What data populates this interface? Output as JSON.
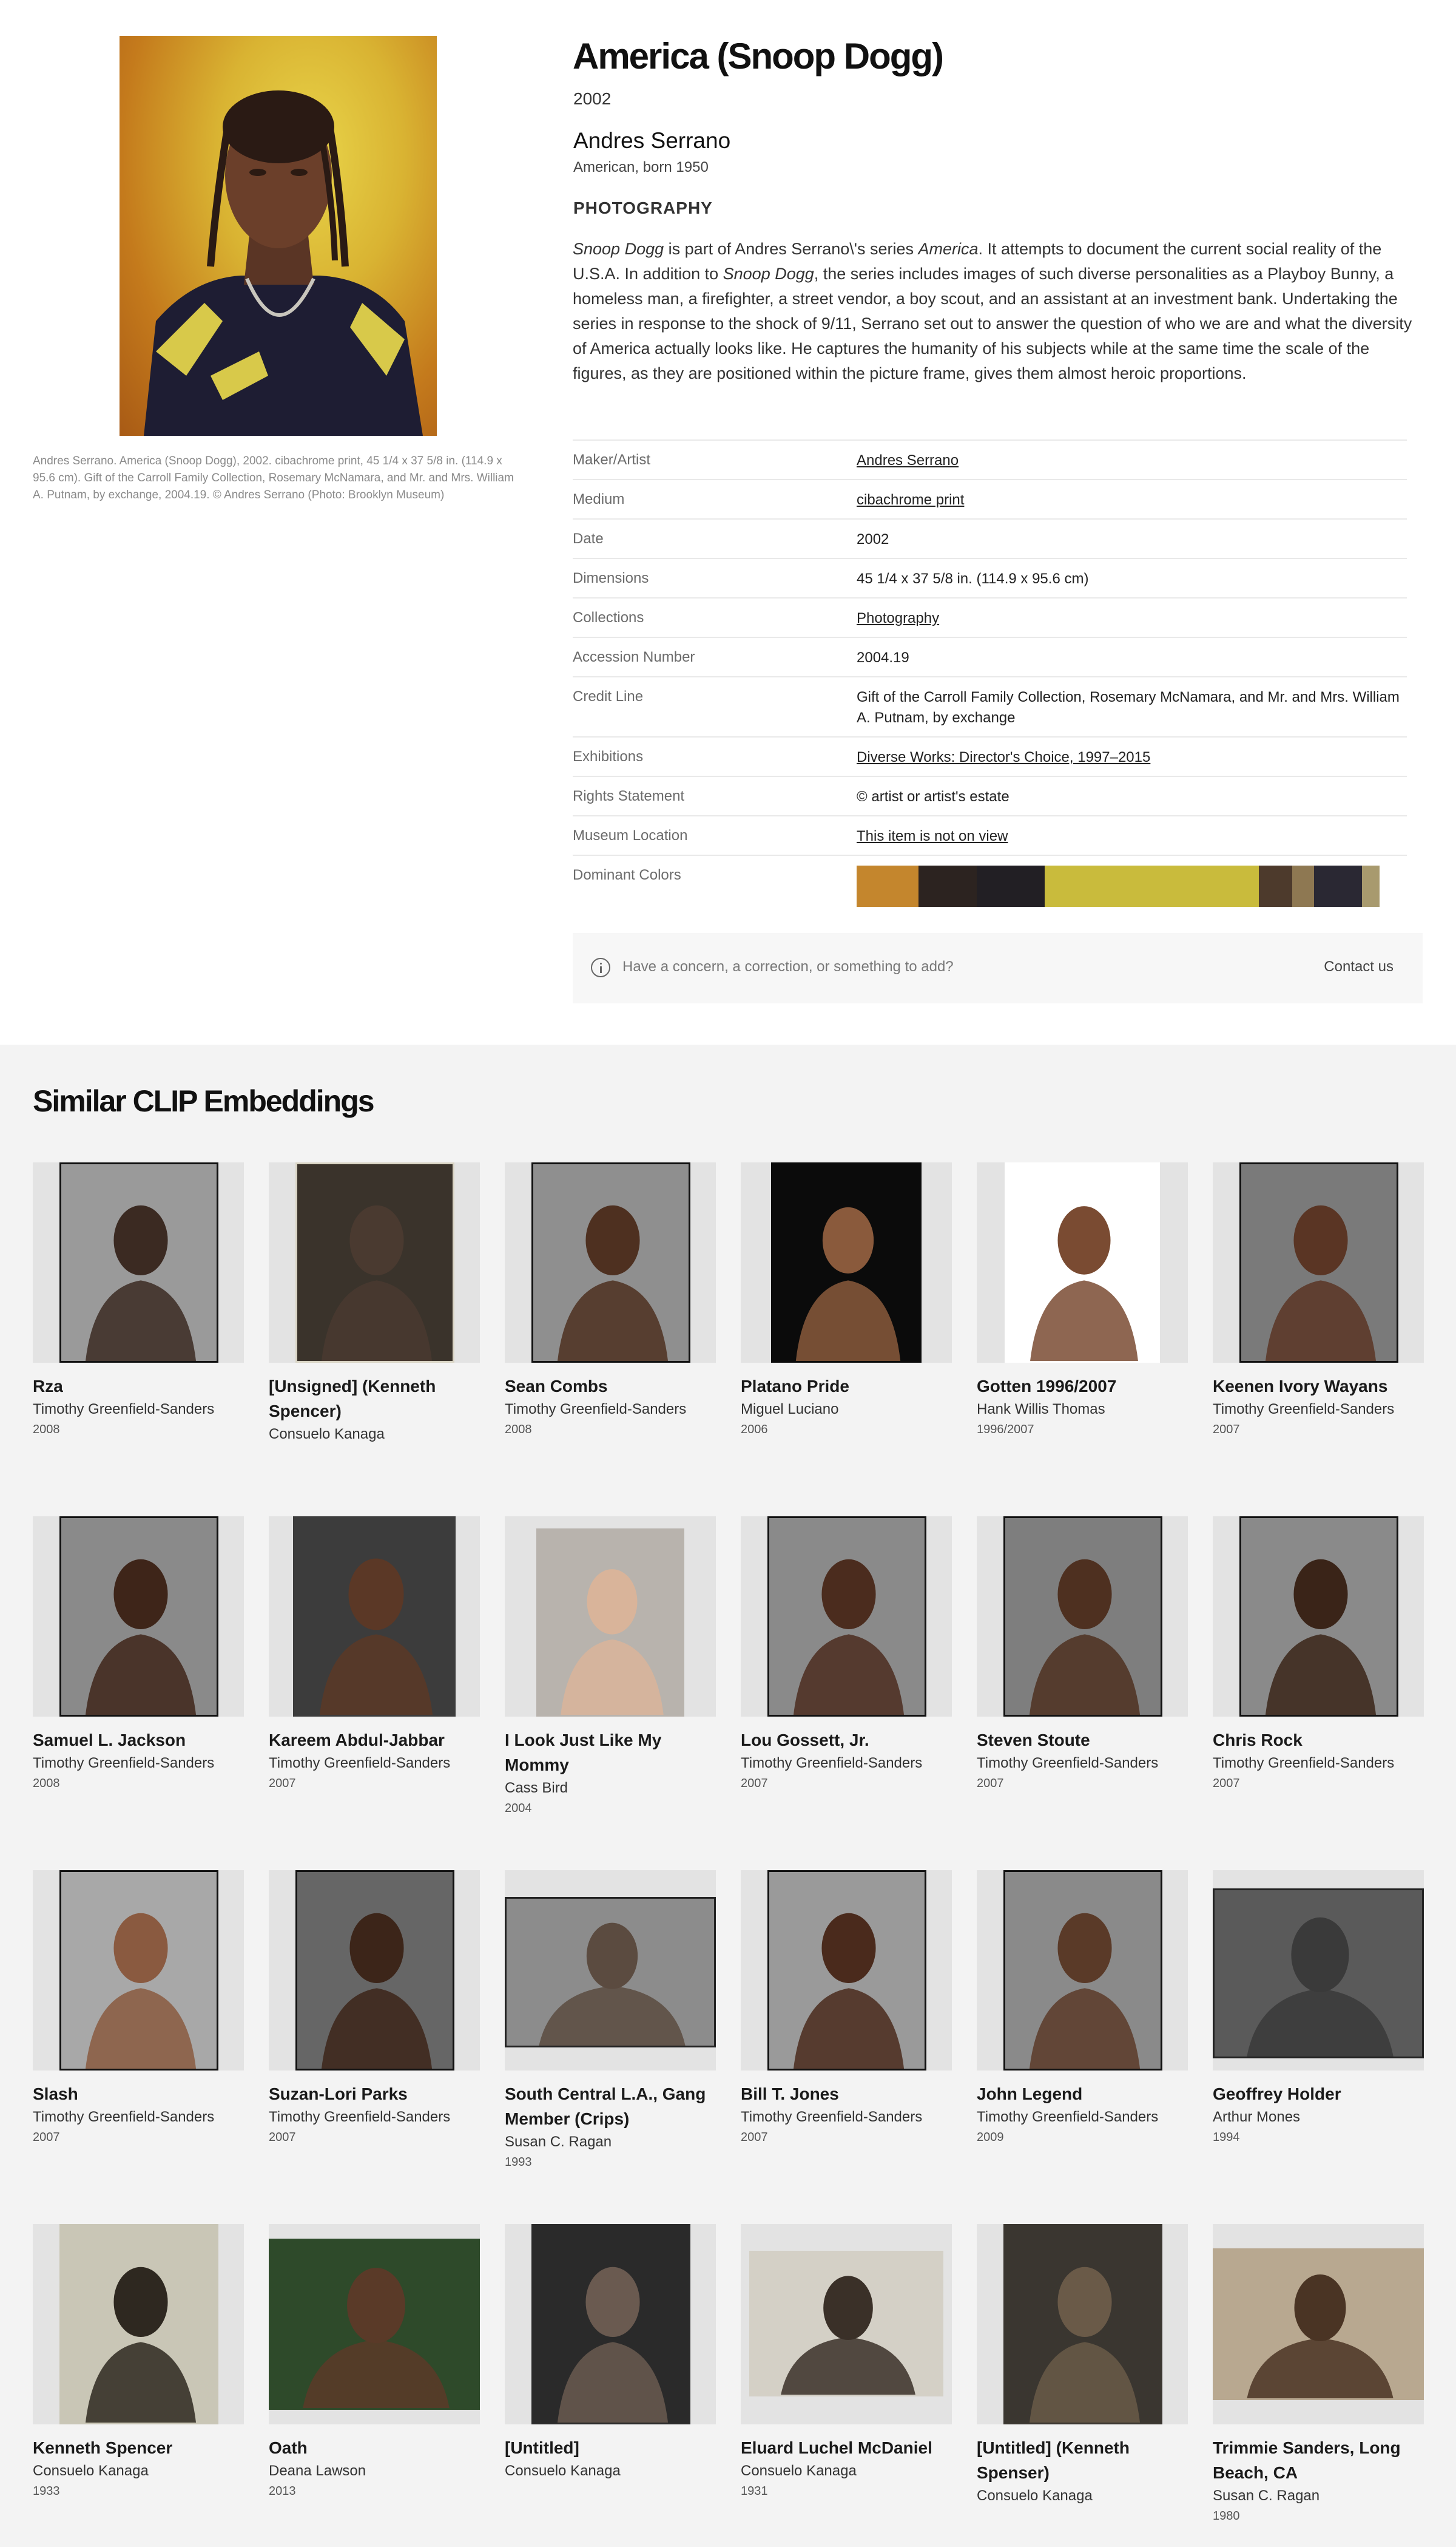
{
  "artwork": {
    "title": "America (Snoop Dogg)",
    "year": "2002",
    "artist": "Andres Serrano",
    "nationality": "American, born 1950",
    "classification": "PHOTOGRAPHY",
    "image_caption": "Andres Serrano. America (Snoop Dogg), 2002. cibachrome print, 45 1/4 x 37 5/8 in. (114.9 x 95.6 cm). Gift of the Carroll Family Collection, Rosemary McNamara, and Mr. and Mrs. William A. Putnam, by exchange, 2004.19. © Andres Serrano (Photo: Brooklyn Museum)",
    "description": {
      "p1_italic": "Snoop Dogg",
      "p2": " is part of Andres Serrano\\'s series ",
      "p3_italic": "America",
      "p4": ". It attempts to document the current social reality of the U.S.A. In addition to ",
      "p5_italic": "Snoop Dogg",
      "p6": ", the series includes images of such diverse personalities as a Playboy Bunny, a homeless man, a firefighter, a street vendor, a boy scout, and an assistant at an investment bank. Undertaking the series in response to the shock of 9/11, Serrano set out to answer the question of who we are and what the diversity of America actually looks like. He captures the humanity of his subjects while at the same time the scale of the figures, as they are positioned within the picture frame, gives them almost heroic proportions."
    }
  },
  "metadata": [
    {
      "label": "Maker/Artist",
      "value": "Andres Serrano",
      "link": true
    },
    {
      "label": "Medium",
      "value": "cibachrome print",
      "link": true
    },
    {
      "label": "Date",
      "value": "2002",
      "link": false
    },
    {
      "label": "Dimensions",
      "value": "45 1/4 x 37 5/8 in. (114.9 x 95.6 cm)",
      "link": false
    },
    {
      "label": "Collections",
      "value": "Photography",
      "link": true
    },
    {
      "label": "Accession Number",
      "value": "2004.19",
      "link": false
    },
    {
      "label": "Credit Line",
      "value": "Gift of the Carroll Family Collection, Rosemary McNamara, and Mr. and Mrs. William A. Putnam, by exchange",
      "link": false
    },
    {
      "label": "Exhibitions",
      "value": "Diverse Works: Director's Choice, 1997–2015",
      "link": true
    },
    {
      "label": "Rights Statement",
      "value": "© artist or artist's estate",
      "link": false
    },
    {
      "label": "Museum Location",
      "value": "This item is not on view",
      "link": true
    },
    {
      "label": "Dominant Colors",
      "value": null,
      "link": false
    }
  ],
  "dominant_colors": [
    {
      "color": "#c4862d",
      "share": 0.112
    },
    {
      "color": "#2c2320",
      "share": 0.106
    },
    {
      "color": "#221f24",
      "share": 0.124
    },
    {
      "color": "#c9bb3c",
      "share": 0.389
    },
    {
      "color": "#4d3a2c",
      "share": 0.061
    },
    {
      "color": "#8e7852",
      "share": 0.039
    },
    {
      "color": "#2a2833",
      "share": 0.088
    },
    {
      "color": "#a89a6e",
      "share": 0.032
    }
  ],
  "concern": {
    "text": "Have a concern, a correction, or something to add?",
    "contact": "Contact us"
  },
  "similar": {
    "heading": "Similar CLIP Embeddings",
    "items": [
      {
        "title": "Rza",
        "artist": "Timothy Greenfield-Sanders",
        "date": "2008"
      },
      {
        "title": "[Unsigned] (Kenneth Spencer)",
        "artist": "Consuelo Kanaga",
        "date": ""
      },
      {
        "title": "Sean Combs",
        "artist": "Timothy Greenfield-Sanders",
        "date": "2008"
      },
      {
        "title": "Platano Pride",
        "artist": "Miguel Luciano",
        "date": "2006"
      },
      {
        "title": "Gotten 1996/2007",
        "artist": "Hank Willis Thomas",
        "date": "1996/2007"
      },
      {
        "title": "Keenen Ivory Wayans",
        "artist": "Timothy Greenfield-Sanders",
        "date": "2007"
      },
      {
        "title": "Samuel L. Jackson",
        "artist": "Timothy Greenfield-Sanders",
        "date": "2008"
      },
      {
        "title": "Kareem Abdul-Jabbar",
        "artist": "Timothy Greenfield-Sanders",
        "date": "2007"
      },
      {
        "title": "I Look Just Like My Mommy",
        "artist": "Cass Bird",
        "date": "2004"
      },
      {
        "title": "Lou Gossett, Jr.",
        "artist": "Timothy Greenfield-Sanders",
        "date": "2007"
      },
      {
        "title": "Steven Stoute",
        "artist": "Timothy Greenfield-Sanders",
        "date": "2007"
      },
      {
        "title": "Chris Rock",
        "artist": "Timothy Greenfield-Sanders",
        "date": "2007"
      },
      {
        "title": "Slash",
        "artist": "Timothy Greenfield-Sanders",
        "date": "2007"
      },
      {
        "title": "Suzan-Lori Parks",
        "artist": "Timothy Greenfield-Sanders",
        "date": "2007"
      },
      {
        "title": "South Central L.A., Gang Member (Crips)",
        "artist": "Susan C. Ragan",
        "date": "1993"
      },
      {
        "title": "Bill T. Jones",
        "artist": "Timothy Greenfield-Sanders",
        "date": "2007"
      },
      {
        "title": "John Legend",
        "artist": "Timothy Greenfield-Sanders",
        "date": "2009"
      },
      {
        "title": "Geoffrey Holder",
        "artist": "Arthur Mones",
        "date": "1994"
      },
      {
        "title": "Kenneth Spencer",
        "artist": "Consuelo Kanaga",
        "date": "1933"
      },
      {
        "title": "Oath",
        "artist": "Deana Lawson",
        "date": "2013"
      },
      {
        "title": "[Untitled]",
        "artist": "Consuelo Kanaga",
        "date": ""
      },
      {
        "title": "Eluard Luchel McDaniel",
        "artist": "Consuelo Kanaga",
        "date": "1931"
      },
      {
        "title": "[Untitled] (Kenneth Spenser)",
        "artist": "Consuelo Kanaga",
        "date": ""
      },
      {
        "title": "Trimmie Sanders, Long Beach, CA",
        "artist": "Susan C. Ragan",
        "date": "1980"
      }
    ]
  }
}
